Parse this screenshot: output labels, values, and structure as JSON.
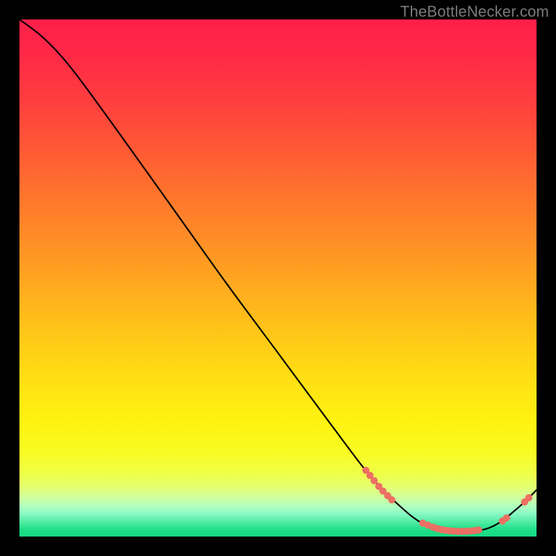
{
  "watermark": "TheBottleNecker.com",
  "colors": {
    "gradient_stops": [
      {
        "offset": 0.0,
        "color": "#ff1f4a"
      },
      {
        "offset": 0.06,
        "color": "#ff2747"
      },
      {
        "offset": 0.15,
        "color": "#ff3c3f"
      },
      {
        "offset": 0.25,
        "color": "#ff5935"
      },
      {
        "offset": 0.35,
        "color": "#ff782c"
      },
      {
        "offset": 0.45,
        "color": "#ff9524"
      },
      {
        "offset": 0.55,
        "color": "#ffb51c"
      },
      {
        "offset": 0.62,
        "color": "#ffca17"
      },
      {
        "offset": 0.7,
        "color": "#ffe013"
      },
      {
        "offset": 0.78,
        "color": "#fff311"
      },
      {
        "offset": 0.84,
        "color": "#f8fc24"
      },
      {
        "offset": 0.88,
        "color": "#eeff4a"
      },
      {
        "offset": 0.905,
        "color": "#e3ff74"
      },
      {
        "offset": 0.925,
        "color": "#cfffa0"
      },
      {
        "offset": 0.942,
        "color": "#b0ffc0"
      },
      {
        "offset": 0.955,
        "color": "#8cf9c4"
      },
      {
        "offset": 0.97,
        "color": "#57eda6"
      },
      {
        "offset": 0.986,
        "color": "#20df88"
      },
      {
        "offset": 1.0,
        "color": "#17d981"
      }
    ],
    "curve": "#000000",
    "marker": "#ec7063",
    "frame_bg": "#000000"
  },
  "chart_data": {
    "type": "line",
    "x_range": [
      0,
      100
    ],
    "y_range": [
      0,
      100
    ],
    "title": "",
    "xlabel": "",
    "ylabel": "",
    "curve": [
      {
        "x": 0,
        "y": 100
      },
      {
        "x": 4,
        "y": 97
      },
      {
        "x": 8,
        "y": 93
      },
      {
        "x": 12,
        "y": 88
      },
      {
        "x": 20,
        "y": 77
      },
      {
        "x": 30,
        "y": 63
      },
      {
        "x": 40,
        "y": 49
      },
      {
        "x": 50,
        "y": 35.5
      },
      {
        "x": 60,
        "y": 22
      },
      {
        "x": 68,
        "y": 11.5
      },
      {
        "x": 74,
        "y": 5.5
      },
      {
        "x": 78,
        "y": 2.5
      },
      {
        "x": 82,
        "y": 1.2
      },
      {
        "x": 86,
        "y": 1.0
      },
      {
        "x": 90,
        "y": 1.4
      },
      {
        "x": 93,
        "y": 2.8
      },
      {
        "x": 96,
        "y": 5.2
      },
      {
        "x": 98,
        "y": 7.0
      },
      {
        "x": 100,
        "y": 9.0
      }
    ],
    "markers": [
      {
        "x": 67.0,
        "y": 12.8
      },
      {
        "x": 67.8,
        "y": 11.8
      },
      {
        "x": 68.6,
        "y": 10.8
      },
      {
        "x": 69.5,
        "y": 9.7
      },
      {
        "x": 70.3,
        "y": 8.8
      },
      {
        "x": 71.2,
        "y": 7.9
      },
      {
        "x": 72.0,
        "y": 7.1
      },
      {
        "x": 78.0,
        "y": 2.6
      },
      {
        "x": 79.0,
        "y": 2.2
      },
      {
        "x": 80.0,
        "y": 1.8
      },
      {
        "x": 80.8,
        "y": 1.55
      },
      {
        "x": 81.6,
        "y": 1.35
      },
      {
        "x": 82.4,
        "y": 1.22
      },
      {
        "x": 83.2,
        "y": 1.12
      },
      {
        "x": 84.0,
        "y": 1.05
      },
      {
        "x": 84.8,
        "y": 1.01
      },
      {
        "x": 85.6,
        "y": 1.0
      },
      {
        "x": 86.4,
        "y": 1.02
      },
      {
        "x": 87.2,
        "y": 1.07
      },
      {
        "x": 88.0,
        "y": 1.15
      },
      {
        "x": 88.8,
        "y": 1.27
      },
      {
        "x": 93.4,
        "y": 3.0
      },
      {
        "x": 94.2,
        "y": 3.6
      },
      {
        "x": 97.7,
        "y": 6.7
      },
      {
        "x": 98.5,
        "y": 7.5
      }
    ]
  }
}
